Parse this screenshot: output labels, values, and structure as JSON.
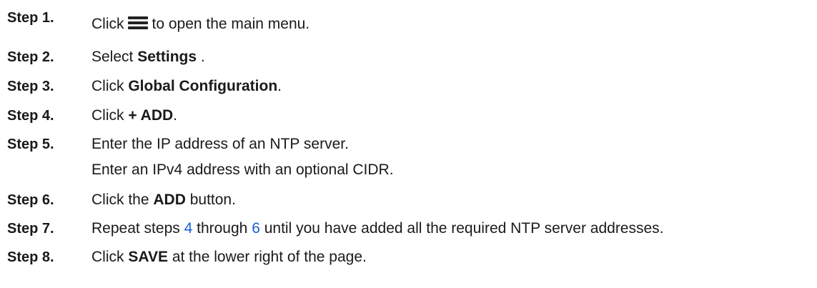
{
  "steps": [
    {
      "label": "Step 1.",
      "prefix": "Click",
      "icon": "hamburger-menu-icon",
      "suffix": "to open the main menu."
    },
    {
      "label": "Step 2.",
      "prefix": "Select",
      "bold": "Settings",
      "suffix": "."
    },
    {
      "label": "Step 3.",
      "prefix": "Click",
      "bold": "Global Configuration",
      "suffix": "."
    },
    {
      "label": "Step 4.",
      "prefix": "Click",
      "bold": "+ ADD",
      "suffix": "."
    },
    {
      "label": "Step 5.",
      "line1": "Enter the IP address of an NTP server.",
      "line2": "Enter an IPv4 address with an optional CIDR."
    },
    {
      "label": "Step 6.",
      "prefix": "Click the",
      "bold": "ADD",
      "suffix": "button."
    },
    {
      "label": "Step 7.",
      "prefix": "Repeat steps",
      "link1": "4",
      "middle": "through",
      "link2": "6",
      "suffix": "until you have added all the required NTP server addresses."
    },
    {
      "label": "Step 8.",
      "prefix": "Click",
      "bold": "SAVE",
      "suffix": "at the lower right of the page."
    }
  ],
  "colors": {
    "text": "#1a1a1a",
    "link": "#1a5fd6"
  }
}
